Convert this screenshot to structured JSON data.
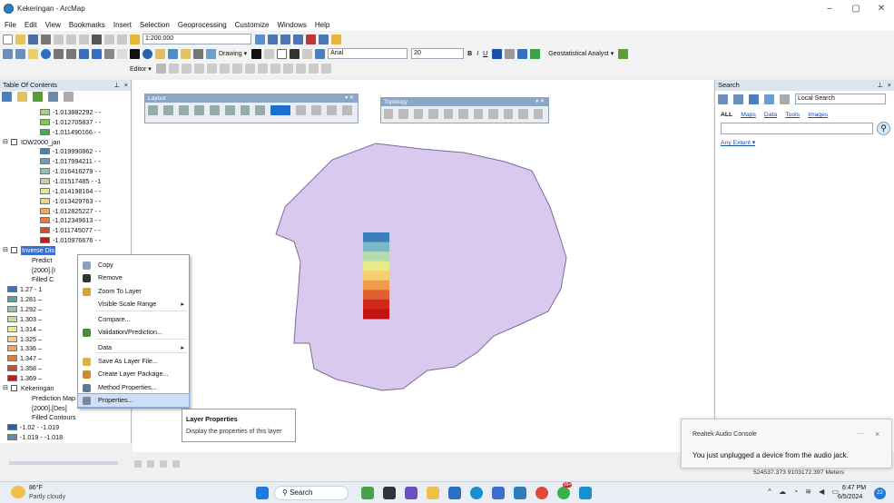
{
  "window": {
    "title": "Kekeringan - ArcMap",
    "minimize": "–",
    "maximize": "▢",
    "close": "✕"
  },
  "menu": [
    "File",
    "Edit",
    "View",
    "Bookmarks",
    "Insert",
    "Selection",
    "Geoprocessing",
    "Customize",
    "Windows",
    "Help"
  ],
  "toolbar": {
    "scale": "1:200.000",
    "drawing": "Drawing ▾",
    "font": "Arial",
    "font_size": "20",
    "geostat": "Geostatistical Analyst ▾",
    "editor": "Editor ▾"
  },
  "toc": {
    "title": "Table Of Contents",
    "rows": [
      {
        "label": "-1.013882292 - -",
        "color": "#9fd96a"
      },
      {
        "label": "-1.012705837 - -",
        "color": "#7cc94f"
      },
      {
        "label": "-1.011490166 - -",
        "color": "#3db33d"
      },
      {
        "label": "IDW2000_jan",
        "color": ""
      },
      {
        "label": "-1.019990862 - -",
        "color": "#4a7fb5"
      },
      {
        "label": "-1.017994211 - -",
        "color": "#6b9fb8"
      },
      {
        "label": "-1.016416279 - -",
        "color": "#8fbfb0"
      },
      {
        "label": "-1.01517485 - -1",
        "color": "#b8d8a0"
      },
      {
        "label": "-1.014198164 - -",
        "color": "#e5e89a"
      },
      {
        "label": "-1.013429763 - -",
        "color": "#f6d37a"
      },
      {
        "label": "-1.012825227 - -",
        "color": "#f0a955"
      },
      {
        "label": "-1.012349613 - -",
        "color": "#e67c3b"
      },
      {
        "label": "-1.011745077 - -",
        "color": "#d84a2a"
      },
      {
        "label": "-1.010976676 - -",
        "color": "#c21a1a"
      },
      {
        "label": "Inverse Dis",
        "color": ""
      },
      {
        "label": "Predict",
        "color": ""
      },
      {
        "label": "[2000].[I",
        "color": ""
      },
      {
        "label": "Filled C",
        "color": ""
      },
      {
        "label": "1.27 - 1",
        "color": "#3b73b9"
      },
      {
        "label": "1.281 –",
        "color": "#5aa0a8"
      },
      {
        "label": "1.292 –",
        "color": "#8ec3a4"
      },
      {
        "label": "1.303 –",
        "color": "#c2df8e"
      },
      {
        "label": "1.314 –",
        "color": "#eee88b"
      },
      {
        "label": "1.325 –",
        "color": "#f8d06c"
      },
      {
        "label": "1.336 –",
        "color": "#f3a64d"
      },
      {
        "label": "1.347 –",
        "color": "#e9763a"
      },
      {
        "label": "1.358 –",
        "color": "#db4827"
      },
      {
        "label": "1.369 –",
        "color": "#c51c1c"
      },
      {
        "label": "Kekeringan",
        "color": ""
      },
      {
        "label": "Prediction Map",
        "color": ""
      },
      {
        "label": "[2000].[Des]",
        "color": ""
      },
      {
        "label": "Filled Contours",
        "color": ""
      },
      {
        "label": "-1.02 - -1.019",
        "color": "#2d5fa8"
      },
      {
        "label": "-1.019 - -1.018",
        "color": "#5a8cc0"
      }
    ]
  },
  "context_menu": [
    {
      "label": "Copy",
      "icon": "copy-icon",
      "icolor": "#8aa0b8"
    },
    {
      "label": "Remove",
      "icon": "remove-icon",
      "icolor": "#333"
    },
    {
      "label": "Zoom To Layer",
      "icon": "zoom-layer-icon",
      "icolor": "#d9a030"
    },
    {
      "label": "Visible Scale Range",
      "icon": "",
      "icolor": "",
      "sub": true
    },
    {
      "label": "Compare...",
      "icon": "",
      "icolor": ""
    },
    {
      "label": "Validation/Prediction...",
      "icon": "validation-icon",
      "icolor": "#4a8a3a"
    },
    {
      "label": "Data",
      "icon": "",
      "icolor": "",
      "sub": true
    },
    {
      "label": "Save As Layer File...",
      "icon": "save-layer-icon",
      "icolor": "#e0b040"
    },
    {
      "label": "Create Layer Package...",
      "icon": "package-icon",
      "icolor": "#d08a30"
    },
    {
      "label": "Method Properties...",
      "icon": "method-icon",
      "icolor": "#5a7a9a"
    },
    {
      "label": "Properties...",
      "icon": "properties-icon",
      "icolor": "#7a8a9a"
    }
  ],
  "tooltip": {
    "title": "Layer Properties",
    "text": "Display the properties of this layer"
  },
  "floating_toolbars": {
    "layout": "Layout",
    "topology": "Topology"
  },
  "search": {
    "title": "Search",
    "scope": "Local Search",
    "tabs": [
      "ALL",
      "Maps",
      "Data",
      "Tools",
      "Images"
    ],
    "extent": "Any Extent ▾"
  },
  "status": {
    "coords": "524537.373  9103172.397 Meters"
  },
  "toast": {
    "app": "Realtek Audio Console",
    "message": "You just unplugged a device from the audio jack."
  },
  "taskbar": {
    "weather_temp": "86°F",
    "weather_desc": "Partly cloudy",
    "search": "Search",
    "time": "6:47 PM",
    "date": "6/5/2024",
    "badge": "22",
    "app_badge": "99+"
  },
  "map": {
    "polygon_color": "#d9c9ef",
    "gradient": [
      "#3d7fbd",
      "#7cb8c4",
      "#b5dba8",
      "#e9e98e",
      "#f7cf6c",
      "#f29a4c",
      "#e25f30",
      "#d02a1d",
      "#c11313"
    ]
  }
}
